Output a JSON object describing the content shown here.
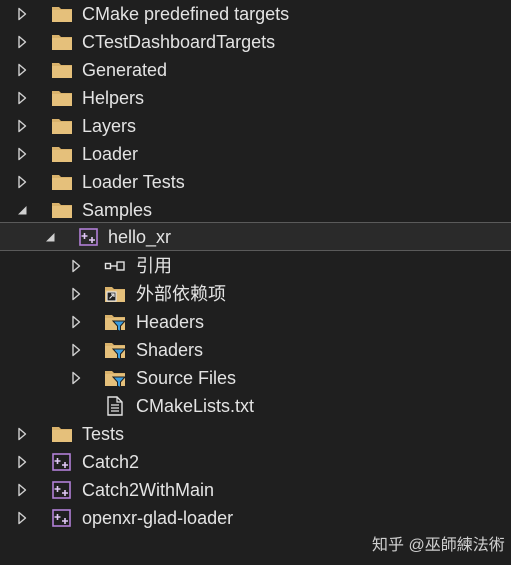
{
  "tree": {
    "rows": [
      {
        "label": "CMake predefined targets",
        "icon": "folder-icon",
        "expanded": false
      },
      {
        "label": "CTestDashboardTargets",
        "icon": "folder-icon",
        "expanded": false
      },
      {
        "label": "Generated",
        "icon": "folder-icon",
        "expanded": false
      },
      {
        "label": "Helpers",
        "icon": "folder-icon",
        "expanded": false
      },
      {
        "label": "Layers",
        "icon": "folder-icon",
        "expanded": false
      },
      {
        "label": "Loader",
        "icon": "folder-icon",
        "expanded": false
      },
      {
        "label": "Loader Tests",
        "icon": "folder-icon",
        "expanded": false
      },
      {
        "label": "Samples",
        "icon": "folder-icon",
        "expanded": true
      },
      {
        "label": "hello_xr",
        "icon": "cmake-target-icon",
        "expanded": true,
        "selected": true
      },
      {
        "label": "引用",
        "icon": "references-icon",
        "expanded": false
      },
      {
        "label": "外部依赖项",
        "icon": "external-dependencies-icon",
        "expanded": false
      },
      {
        "label": "Headers",
        "icon": "filter-folder-icon",
        "expanded": false
      },
      {
        "label": "Shaders",
        "icon": "filter-folder-icon",
        "expanded": false
      },
      {
        "label": "Source Files",
        "icon": "filter-folder-icon",
        "expanded": false
      },
      {
        "label": "CMakeLists.txt",
        "icon": "text-file-icon"
      },
      {
        "label": "Tests",
        "icon": "folder-icon",
        "expanded": false
      },
      {
        "label": "Catch2",
        "icon": "cmake-target-icon",
        "expanded": false
      },
      {
        "label": "Catch2WithMain",
        "icon": "cmake-target-icon",
        "expanded": false
      },
      {
        "label": "openxr-glad-loader",
        "icon": "cmake-target-icon",
        "expanded": false
      }
    ]
  },
  "watermark": {
    "text": "知乎 @巫師練法術"
  },
  "colors": {
    "background": "#1f1f1f",
    "text": "#e3e3e3",
    "folder": "#d9b26b",
    "filter_funnel": "#3c9dde",
    "target_purple": "#b180d7"
  }
}
